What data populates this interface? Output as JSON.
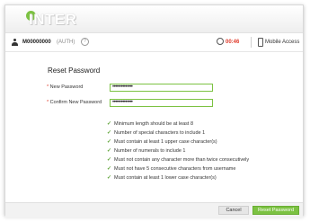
{
  "header": {
    "logo_text": "INTER"
  },
  "userbar": {
    "user_id": "M00000000",
    "auth_label": "(AUTH)",
    "help_symbol": "?",
    "timer": "00:46",
    "mobile_label": "Mobile Access"
  },
  "form": {
    "title": "Reset Password",
    "required_mark": "*",
    "new_password_label": "New Password",
    "new_password_value": "••••••••••••••",
    "confirm_password_label": "Confirm New Password",
    "confirm_password_value": "••••••••••••••"
  },
  "rules": [
    "Minimum length should be at least 8",
    "Number of special characters to include 1",
    "Must contain at least 1 upper case character(s)",
    "Number of numerals to include 1",
    "Must not contain any character more than twice consecutively",
    "Must not have 5 consecutive characters from username",
    "Must contain at least 1 lower case character(s)"
  ],
  "footer": {
    "cancel_label": "Cancel",
    "reset_label": "Reset Password"
  },
  "colors": {
    "accent": "#7cc242",
    "timer": "#e03a2a"
  }
}
